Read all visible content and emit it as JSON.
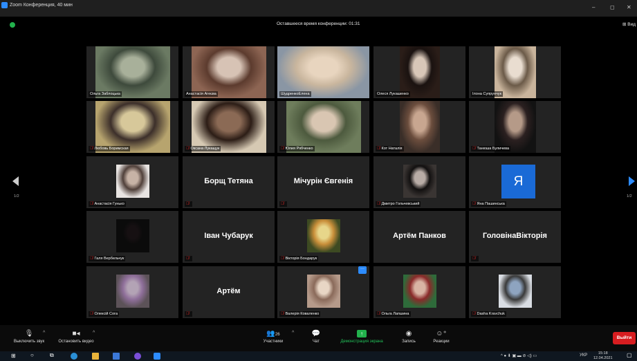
{
  "window": {
    "title": "Zoom Конференция, 40 мин",
    "minimize": "–",
    "maximize": "◻",
    "close": "✕"
  },
  "top": {
    "timer": "Оставшееся время конференции: 01:31",
    "view": "Вид"
  },
  "pager": {
    "left": "1/2",
    "right": "1/2"
  },
  "participants": [
    {
      "name": "Ольга Заблоцька",
      "muted": false,
      "video": true,
      "colors": [
        "#6b7a63",
        "#a8b09a",
        "#3e4a3c"
      ]
    },
    {
      "name": "Анастасія Агеєва",
      "muted": false,
      "video": true,
      "colors": [
        "#8d6553",
        "#d7c3b5",
        "#5c3b2e"
      ]
    },
    {
      "name": "ШудренкоЕлена",
      "muted": false,
      "video": true,
      "active": true,
      "colors": [
        "#8a96a4",
        "#e8d5bf",
        "#c9b69e"
      ]
    },
    {
      "name": "Олеся Лукашенко",
      "muted": false,
      "video": true,
      "colors": [
        "#2a1d18",
        "#d8c7b8",
        "#1a1210"
      ]
    },
    {
      "name": "Ілона Супрунчук",
      "muted": false,
      "video": true,
      "colors": [
        "#c9b49c",
        "#e9ddd0",
        "#6b5a48"
      ]
    },
    {
      "name": "Любовь Боримская",
      "muted": true,
      "video": true,
      "colors": [
        "#b7a46e",
        "#d7c89a",
        "#3c2f2a"
      ]
    },
    {
      "name": "Оксана Лукащук",
      "muted": true,
      "video": true,
      "colors": [
        "#d6c9b3",
        "#8b6a55",
        "#2c1d16"
      ]
    },
    {
      "name": "Юлия Рябченко",
      "muted": true,
      "video": true,
      "colors": [
        "#6e7d5c",
        "#d9c6b2",
        "#4d5a3e"
      ]
    },
    {
      "name": "Кот Наталія",
      "muted": true,
      "video": true,
      "colors": [
        "#3a2e28",
        "#c8a690",
        "#6b4d3d"
      ]
    },
    {
      "name": "Танюша Буличева",
      "muted": true,
      "video": true,
      "colors": [
        "#121212",
        "#b59a88",
        "#2b2020"
      ]
    },
    {
      "name": "Анастасія Гунько",
      "muted": true,
      "video": true,
      "colors": [
        "#e8e4e2",
        "#c7b3a6",
        "#50403a"
      ]
    },
    {
      "name": "",
      "big": "Борщ Тетяна",
      "muted": true,
      "video": false
    },
    {
      "name": "",
      "big": "Мічурін Євгенія",
      "muted": true,
      "video": false
    },
    {
      "name": "Дмитро Гольчевський",
      "muted": true,
      "video": true,
      "colors": [
        "#3a3533",
        "#b8aca6",
        "#121010"
      ]
    },
    {
      "name": "Яна Пашинська",
      "muted": true,
      "video": false,
      "letter": "Я"
    },
    {
      "name": "Галя Вербельчук",
      "muted": true,
      "video": true,
      "colors": [
        "#0b0b0b",
        "#161012",
        "#0b0b0b"
      ]
    },
    {
      "name": "",
      "big": "Іван Чубарук",
      "muted": true,
      "video": false
    },
    {
      "name": "Вікторія Бондарук",
      "muted": true,
      "video": true,
      "colors": [
        "#3d4a22",
        "#e7d68a",
        "#c98f3a"
      ]
    },
    {
      "name": "",
      "big": "Артём Панков",
      "muted": false,
      "video": false
    },
    {
      "name": "",
      "big": "ГоловінаВікторія",
      "muted": true,
      "video": false
    },
    {
      "name": "Олексій Сога",
      "muted": true,
      "video": true,
      "colors": [
        "#5c5258",
        "#b3a3b5",
        "#8f6f9a"
      ]
    },
    {
      "name": "",
      "big": "Артём",
      "muted": true,
      "video": false
    },
    {
      "name": "Валерія Коваленко",
      "muted": true,
      "video": true,
      "more": true,
      "colors": [
        "#b59a8a",
        "#e8d6c5",
        "#8a6a5a"
      ]
    },
    {
      "name": "Ольга Лапшина",
      "muted": true,
      "video": true,
      "colors": [
        "#2e6b3a",
        "#d9b4a4",
        "#8a2a2a"
      ]
    },
    {
      "name": "Dasha Kravchuk",
      "muted": true,
      "video": true,
      "colors": [
        "#d9dde3",
        "#8ea4c0",
        "#3a3a3a"
      ]
    }
  ],
  "toolbar": {
    "mute": "Выключить звук",
    "video": "Остановить видео",
    "participants": "Участники",
    "participants_count": "26",
    "chat": "Чат",
    "share": "Демонстрация экрана",
    "record": "Запись",
    "reactions": "Реакции",
    "leave": "Выйти"
  },
  "taskbar": {
    "lang": "УКР",
    "time": "15:18",
    "date": "12.04.2021"
  }
}
